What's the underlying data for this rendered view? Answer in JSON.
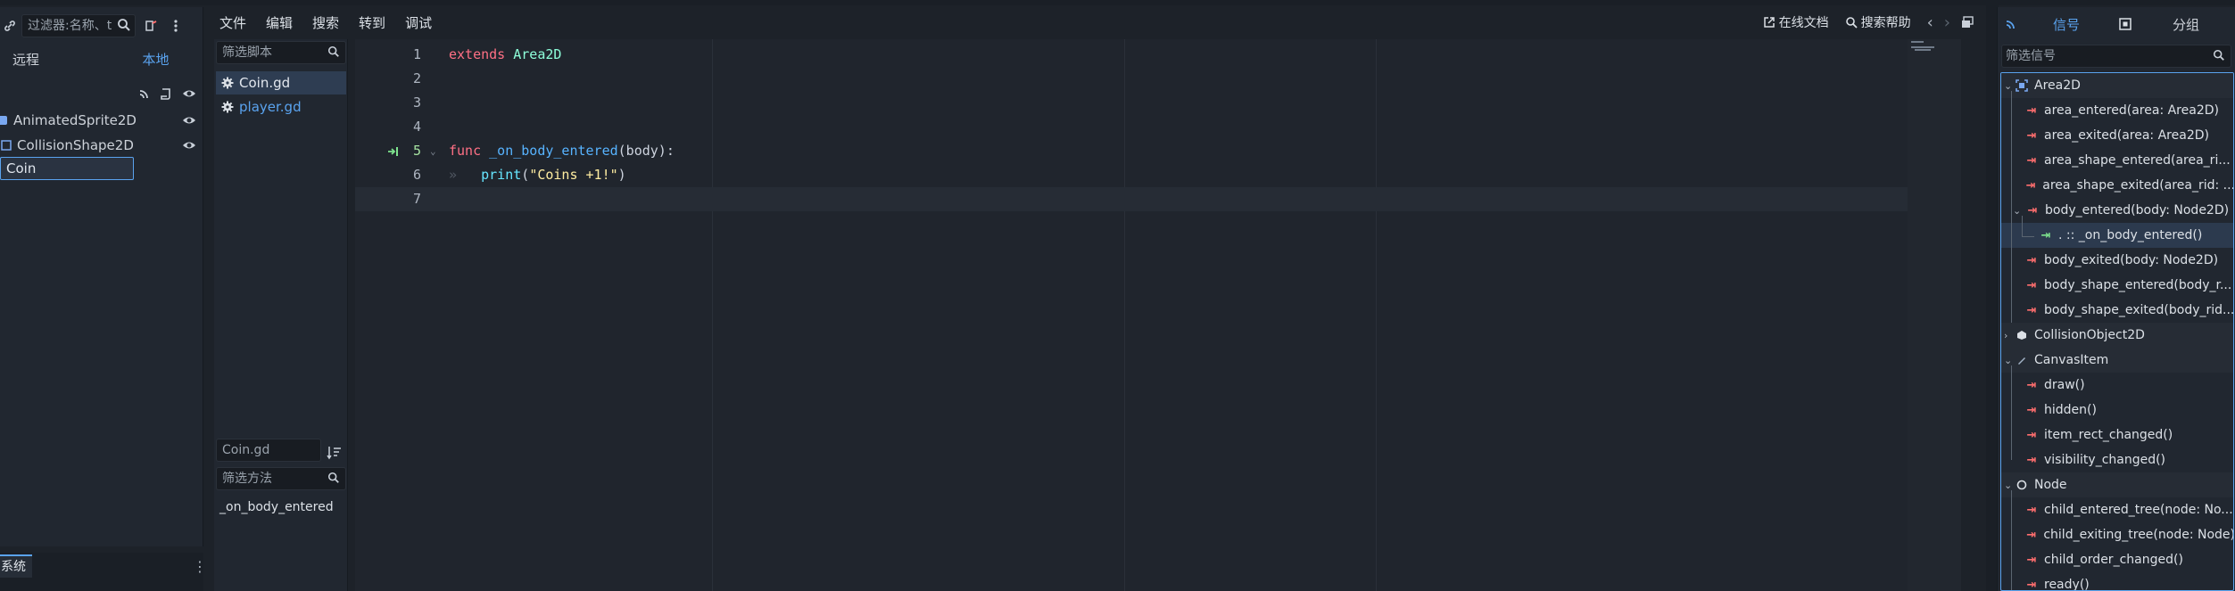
{
  "scene_dock": {
    "filter_placeholder": "过滤器:名称、t",
    "tab_remote": "远程",
    "tab_local": "本地",
    "root_node_name": "Coin",
    "children": [
      "AnimatedSprite2D",
      "CollisionShape2D"
    ],
    "bottom_tab": "系统"
  },
  "menu": {
    "items": [
      "文件",
      "编辑",
      "搜索",
      "转到",
      "调试"
    ],
    "online_docs": "在线文档",
    "search_help": "搜索帮助"
  },
  "script_list": {
    "filter_placeholder": "筛选脚本",
    "scripts": [
      "Coin.gd",
      "player.gd"
    ],
    "current_script": "Coin.gd",
    "method_filter_placeholder": "筛选方法",
    "methods": [
      "_on_body_entered"
    ]
  },
  "code": {
    "line_numbers": [
      "1",
      "2",
      "3",
      "4",
      "5",
      "6",
      "7"
    ],
    "l1_kw": "extends",
    "l1_cls": "Area2D",
    "l5_kw": "func",
    "l5_fn": "_on_body_entered",
    "l5_rest": "(body):",
    "l6_fn": "print",
    "l6_open": "(",
    "l6_str": "\"Coins +1!\"",
    "l6_close": ")"
  },
  "node_dock": {
    "tab_signals": "信号",
    "tab_groups": "分组",
    "filter_placeholder": "筛选信号",
    "sections": {
      "area2d": "Area2D",
      "collisionobject2d": "CollisionObject2D",
      "canvasitem": "CanvasItem",
      "node": "Node"
    },
    "area2d_signals": [
      "area_entered(area: Area2D)",
      "area_exited(area: Area2D)",
      "area_shape_entered(area_ri...",
      "area_shape_exited(area_rid: ...",
      "body_entered(body: Node2D)"
    ],
    "connection": ". :: _on_body_entered()",
    "area2d_signals_after": [
      "body_exited(body: Node2D)",
      "body_shape_entered(body_r...",
      "body_shape_exited(body_rid..."
    ],
    "canvasitem_signals": [
      "draw()",
      "hidden()",
      "item_rect_changed()",
      "visibility_changed()"
    ],
    "node_signals": [
      "child_entered_tree(node: No...",
      "child_exiting_tree(node: Node)",
      "child_order_changed()",
      "ready()"
    ]
  },
  "colors": {
    "accent": "#5aa3ef",
    "keyword": "#ff7085",
    "class": "#8effda",
    "function": "#57b3ff",
    "string": "#ffeda1",
    "signal_icon": "#ff6e6e",
    "connected_icon": "#7ee38e"
  }
}
